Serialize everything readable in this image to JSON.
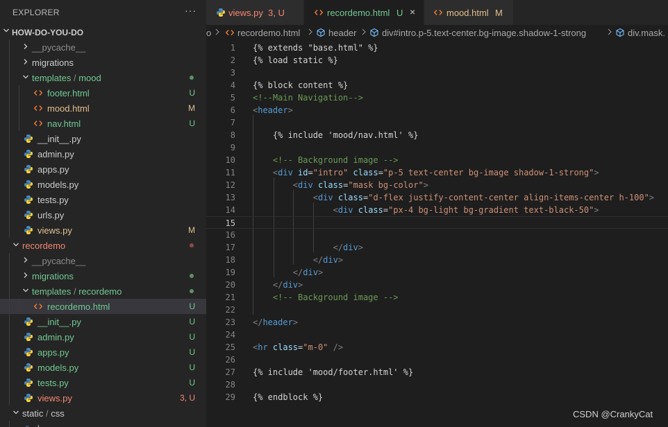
{
  "sidebar": {
    "title": "EXPLORER",
    "more": "···",
    "project": "HOW-DO-YOU-DO"
  },
  "tree": [
    {
      "depth": 1,
      "type": "folder",
      "open": false,
      "parts": [
        {
          "t": "__pycache__",
          "c": "c-muted"
        }
      ]
    },
    {
      "depth": 1,
      "type": "folder",
      "open": false,
      "parts": [
        {
          "t": "migrations",
          "c": "c-default"
        }
      ]
    },
    {
      "depth": 1,
      "type": "folder",
      "open": true,
      "parts": [
        {
          "t": "templates",
          "c": "c-green"
        },
        {
          "t": " / ",
          "c": "c-muted"
        },
        {
          "t": "mood",
          "c": "c-green"
        }
      ],
      "dot": "#5f8f6a"
    },
    {
      "depth": 2,
      "type": "html",
      "parts": [
        {
          "t": "footer.html",
          "c": "c-green"
        }
      ],
      "status": "U",
      "sc": "c-green"
    },
    {
      "depth": 2,
      "type": "html",
      "parts": [
        {
          "t": "mood.html",
          "c": "c-mod"
        }
      ],
      "status": "M",
      "sc": "c-mod"
    },
    {
      "depth": 2,
      "type": "html",
      "parts": [
        {
          "t": "nav.html",
          "c": "c-green"
        }
      ],
      "status": "U",
      "sc": "c-green"
    },
    {
      "depth": 1,
      "type": "py",
      "parts": [
        {
          "t": "__init__.py",
          "c": "c-default"
        }
      ]
    },
    {
      "depth": 1,
      "type": "py",
      "parts": [
        {
          "t": "admin.py",
          "c": "c-default"
        }
      ]
    },
    {
      "depth": 1,
      "type": "py",
      "parts": [
        {
          "t": "apps.py",
          "c": "c-default"
        }
      ]
    },
    {
      "depth": 1,
      "type": "py",
      "parts": [
        {
          "t": "models.py",
          "c": "c-default"
        }
      ]
    },
    {
      "depth": 1,
      "type": "py",
      "parts": [
        {
          "t": "tests.py",
          "c": "c-default"
        }
      ]
    },
    {
      "depth": 1,
      "type": "py",
      "parts": [
        {
          "t": "urls.py",
          "c": "c-default"
        }
      ]
    },
    {
      "depth": 1,
      "type": "py",
      "parts": [
        {
          "t": "views.py",
          "c": "c-mod"
        }
      ],
      "status": "M",
      "sc": "c-mod"
    },
    {
      "depth": 0,
      "type": "folder",
      "open": true,
      "parts": [
        {
          "t": "recordemo",
          "c": "c-err"
        }
      ],
      "dot": "#8a4b44"
    },
    {
      "depth": 1,
      "type": "folder",
      "open": false,
      "parts": [
        {
          "t": "__pycache__",
          "c": "c-muted"
        }
      ]
    },
    {
      "depth": 1,
      "type": "folder",
      "open": false,
      "parts": [
        {
          "t": "migrations",
          "c": "c-green"
        }
      ],
      "dot": "#5f8f6a"
    },
    {
      "depth": 1,
      "type": "folder",
      "open": true,
      "parts": [
        {
          "t": "templates",
          "c": "c-green"
        },
        {
          "t": " / ",
          "c": "c-muted"
        },
        {
          "t": "recordemo",
          "c": "c-green"
        }
      ],
      "dot": "#5f8f6a"
    },
    {
      "depth": 2,
      "type": "html",
      "parts": [
        {
          "t": "recordemo.html",
          "c": "c-green"
        }
      ],
      "status": "U",
      "sc": "c-green",
      "selected": true
    },
    {
      "depth": 1,
      "type": "py",
      "parts": [
        {
          "t": "__init__.py",
          "c": "c-green"
        }
      ],
      "status": "U",
      "sc": "c-green"
    },
    {
      "depth": 1,
      "type": "py",
      "parts": [
        {
          "t": "admin.py",
          "c": "c-green"
        }
      ],
      "status": "U",
      "sc": "c-green"
    },
    {
      "depth": 1,
      "type": "py",
      "parts": [
        {
          "t": "apps.py",
          "c": "c-green"
        }
      ],
      "status": "U",
      "sc": "c-green"
    },
    {
      "depth": 1,
      "type": "py",
      "parts": [
        {
          "t": "models.py",
          "c": "c-green"
        }
      ],
      "status": "U",
      "sc": "c-green"
    },
    {
      "depth": 1,
      "type": "py",
      "parts": [
        {
          "t": "tests.py",
          "c": "c-green"
        }
      ],
      "status": "U",
      "sc": "c-green"
    },
    {
      "depth": 1,
      "type": "py",
      "parts": [
        {
          "t": "views.py",
          "c": "c-err"
        }
      ],
      "status": "3, U",
      "sc": "c-err"
    },
    {
      "depth": 0,
      "type": "folder",
      "open": true,
      "parts": [
        {
          "t": "static",
          "c": "c-default"
        },
        {
          "t": " / ",
          "c": "c-muted"
        },
        {
          "t": "css",
          "c": "c-default"
        }
      ]
    },
    {
      "depth": 1,
      "type": "css",
      "parts": [
        {
          "t": "base.css",
          "c": "c-default"
        }
      ]
    }
  ],
  "tabs": [
    {
      "icon": "python-icon",
      "label": "views.py",
      "label_color": "#f48771",
      "status": "3, U",
      "status_color": "#f48771"
    },
    {
      "icon": "html-icon",
      "label": "recordemo.html",
      "label_color": "#73c991",
      "status": "U",
      "status_color": "#73c991",
      "close": "×"
    },
    {
      "icon": "html-icon",
      "label": "mood.html",
      "label_color": "#e2c08d",
      "status": "M",
      "status_color": "#e2c08d"
    }
  ],
  "breadcrumb": [
    "o",
    "recordemo.html",
    "header",
    "div#intro.p-5.text-center.bg-image.shadow-1-strong",
    "div.mask."
  ],
  "code": [
    {
      "n": "1",
      "t": [
        [
          "{% extends \"base.html\" %}",
          "tk-tpl"
        ]
      ]
    },
    {
      "n": "2",
      "t": [
        [
          "{% load static %}",
          "tk-tpl"
        ]
      ]
    },
    {
      "n": "3",
      "t": []
    },
    {
      "n": "4",
      "t": [
        [
          "{% block content %}",
          "tk-tpl"
        ]
      ]
    },
    {
      "n": "5",
      "t": [
        [
          "<!--Main Navigation-->",
          "tk-cmt"
        ]
      ]
    },
    {
      "n": "6",
      "t": [
        [
          "<",
          "tk-punc"
        ],
        [
          "header",
          "tk-tag"
        ],
        [
          ">",
          "tk-punc"
        ]
      ]
    },
    {
      "n": "7",
      "t": []
    },
    {
      "n": "8",
      "t": [
        [
          "    {% include 'mood/nav.html' %}",
          "tk-tpl"
        ]
      ]
    },
    {
      "n": "9",
      "t": []
    },
    {
      "n": "10",
      "t": [
        [
          "    ",
          "tk-plain"
        ],
        [
          "<!-- Background image -->",
          "tk-cmt"
        ]
      ]
    },
    {
      "n": "11",
      "t": [
        [
          "    ",
          "tk-plain"
        ],
        [
          "<",
          "tk-punc"
        ],
        [
          "div",
          "tk-tag"
        ],
        [
          " id",
          "tk-attr"
        ],
        [
          "=",
          "tk-plain"
        ],
        [
          "\"intro\"",
          "tk-str"
        ],
        [
          " class",
          "tk-attr"
        ],
        [
          "=",
          "tk-plain"
        ],
        [
          "\"p-5 text-center bg-image shadow-1-strong\"",
          "tk-str"
        ],
        [
          ">",
          "tk-punc"
        ]
      ]
    },
    {
      "n": "12",
      "t": [
        [
          "        ",
          "tk-plain"
        ],
        [
          "<",
          "tk-punc"
        ],
        [
          "div",
          "tk-tag"
        ],
        [
          " class",
          "tk-attr"
        ],
        [
          "=",
          "tk-plain"
        ],
        [
          "\"mask bg-color\"",
          "tk-str"
        ],
        [
          ">",
          "tk-punc"
        ]
      ]
    },
    {
      "n": "13",
      "t": [
        [
          "            ",
          "tk-plain"
        ],
        [
          "<",
          "tk-punc"
        ],
        [
          "div",
          "tk-tag"
        ],
        [
          " class",
          "tk-attr"
        ],
        [
          "=",
          "tk-plain"
        ],
        [
          "\"d-flex justify-content-center align-items-center h-100\"",
          "tk-str"
        ],
        [
          ">",
          "tk-punc"
        ]
      ]
    },
    {
      "n": "14",
      "t": [
        [
          "                ",
          "tk-plain"
        ],
        [
          "<",
          "tk-punc"
        ],
        [
          "div",
          "tk-tag"
        ],
        [
          " class",
          "tk-attr"
        ],
        [
          "=",
          "tk-plain"
        ],
        [
          "\"px-4 bg-light bg-gradient text-black-50\"",
          "tk-str"
        ],
        [
          ">",
          "tk-punc"
        ]
      ]
    },
    {
      "n": "15",
      "t": [],
      "active": true
    },
    {
      "n": "16",
      "t": []
    },
    {
      "n": "17",
      "t": [
        [
          "                ",
          "tk-plain"
        ],
        [
          "</",
          "tk-punc"
        ],
        [
          "div",
          "tk-tag"
        ],
        [
          ">",
          "tk-punc"
        ]
      ]
    },
    {
      "n": "18",
      "t": [
        [
          "            ",
          "tk-plain"
        ],
        [
          "</",
          "tk-punc"
        ],
        [
          "div",
          "tk-tag"
        ],
        [
          ">",
          "tk-punc"
        ]
      ]
    },
    {
      "n": "19",
      "t": [
        [
          "        ",
          "tk-plain"
        ],
        [
          "</",
          "tk-punc"
        ],
        [
          "div",
          "tk-tag"
        ],
        [
          ">",
          "tk-punc"
        ]
      ]
    },
    {
      "n": "20",
      "t": [
        [
          "    ",
          "tk-plain"
        ],
        [
          "</",
          "tk-punc"
        ],
        [
          "div",
          "tk-tag"
        ],
        [
          ">",
          "tk-punc"
        ]
      ]
    },
    {
      "n": "21",
      "t": [
        [
          "    ",
          "tk-plain"
        ],
        [
          "<!-- Background image -->",
          "tk-cmt"
        ]
      ]
    },
    {
      "n": "22",
      "t": []
    },
    {
      "n": "23",
      "t": [
        [
          "</",
          "tk-punc"
        ],
        [
          "header",
          "tk-tag"
        ],
        [
          ">",
          "tk-punc"
        ]
      ]
    },
    {
      "n": "24",
      "t": []
    },
    {
      "n": "25",
      "t": [
        [
          "<",
          "tk-punc"
        ],
        [
          "hr",
          "tk-tag"
        ],
        [
          " class",
          "tk-attr"
        ],
        [
          "=",
          "tk-plain"
        ],
        [
          "\"m-0\"",
          "tk-str"
        ],
        [
          " />",
          "tk-punc"
        ]
      ]
    },
    {
      "n": "26",
      "t": []
    },
    {
      "n": "27",
      "t": [
        [
          "{% include 'mood/footer.html' %}",
          "tk-tpl"
        ]
      ]
    },
    {
      "n": "28",
      "t": []
    },
    {
      "n": "29",
      "t": [
        [
          "{% endblock %}",
          "tk-tpl"
        ]
      ]
    }
  ],
  "watermark": "CSDN @CrankyCat"
}
